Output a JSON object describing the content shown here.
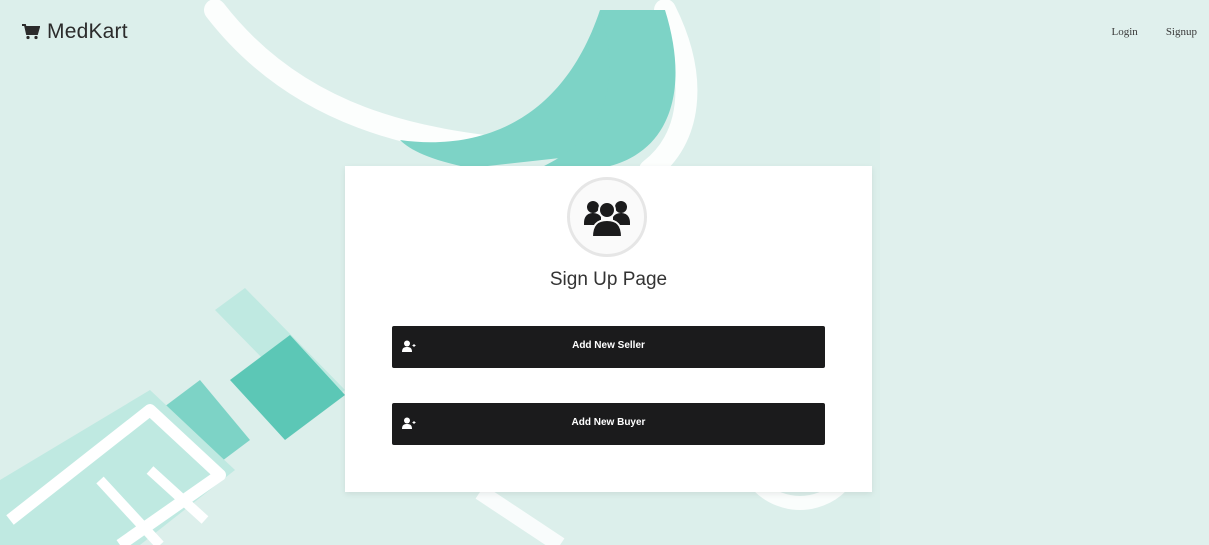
{
  "brand": {
    "name": "MedKart",
    "icon": "shopping-cart-icon"
  },
  "nav": {
    "login_label": "Login",
    "signup_label": "Signup"
  },
  "card": {
    "avatar_icon": "users-group-icon",
    "title": "Sign Up Page",
    "buttons": [
      {
        "label": "Add New Seller",
        "icon": "user-add-icon"
      },
      {
        "label": "Add New Buyer",
        "icon": "user-add-icon"
      }
    ]
  },
  "colors": {
    "background": "#dcefeb",
    "accent_teal": "#7dd3c6",
    "light_teal": "#b7e6dd",
    "button": "#1b1b1c",
    "card": "#ffffff"
  }
}
